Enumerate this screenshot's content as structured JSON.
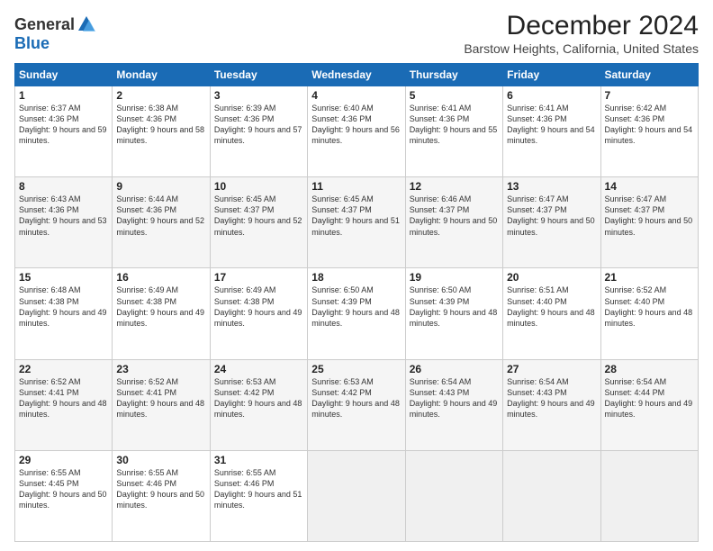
{
  "header": {
    "logo_general": "General",
    "logo_blue": "Blue",
    "title": "December 2024",
    "location": "Barstow Heights, California, United States"
  },
  "days_of_week": [
    "Sunday",
    "Monday",
    "Tuesday",
    "Wednesday",
    "Thursday",
    "Friday",
    "Saturday"
  ],
  "weeks": [
    [
      {
        "day": "1",
        "sunrise": "6:37 AM",
        "sunset": "4:36 PM",
        "daylight": "9 hours and 59 minutes."
      },
      {
        "day": "2",
        "sunrise": "6:38 AM",
        "sunset": "4:36 PM",
        "daylight": "9 hours and 58 minutes."
      },
      {
        "day": "3",
        "sunrise": "6:39 AM",
        "sunset": "4:36 PM",
        "daylight": "9 hours and 57 minutes."
      },
      {
        "day": "4",
        "sunrise": "6:40 AM",
        "sunset": "4:36 PM",
        "daylight": "9 hours and 56 minutes."
      },
      {
        "day": "5",
        "sunrise": "6:41 AM",
        "sunset": "4:36 PM",
        "daylight": "9 hours and 55 minutes."
      },
      {
        "day": "6",
        "sunrise": "6:41 AM",
        "sunset": "4:36 PM",
        "daylight": "9 hours and 54 minutes."
      },
      {
        "day": "7",
        "sunrise": "6:42 AM",
        "sunset": "4:36 PM",
        "daylight": "9 hours and 54 minutes."
      }
    ],
    [
      {
        "day": "8",
        "sunrise": "6:43 AM",
        "sunset": "4:36 PM",
        "daylight": "9 hours and 53 minutes."
      },
      {
        "day": "9",
        "sunrise": "6:44 AM",
        "sunset": "4:36 PM",
        "daylight": "9 hours and 52 minutes."
      },
      {
        "day": "10",
        "sunrise": "6:45 AM",
        "sunset": "4:37 PM",
        "daylight": "9 hours and 52 minutes."
      },
      {
        "day": "11",
        "sunrise": "6:45 AM",
        "sunset": "4:37 PM",
        "daylight": "9 hours and 51 minutes."
      },
      {
        "day": "12",
        "sunrise": "6:46 AM",
        "sunset": "4:37 PM",
        "daylight": "9 hours and 50 minutes."
      },
      {
        "day": "13",
        "sunrise": "6:47 AM",
        "sunset": "4:37 PM",
        "daylight": "9 hours and 50 minutes."
      },
      {
        "day": "14",
        "sunrise": "6:47 AM",
        "sunset": "4:37 PM",
        "daylight": "9 hours and 50 minutes."
      }
    ],
    [
      {
        "day": "15",
        "sunrise": "6:48 AM",
        "sunset": "4:38 PM",
        "daylight": "9 hours and 49 minutes."
      },
      {
        "day": "16",
        "sunrise": "6:49 AM",
        "sunset": "4:38 PM",
        "daylight": "9 hours and 49 minutes."
      },
      {
        "day": "17",
        "sunrise": "6:49 AM",
        "sunset": "4:38 PM",
        "daylight": "9 hours and 49 minutes."
      },
      {
        "day": "18",
        "sunrise": "6:50 AM",
        "sunset": "4:39 PM",
        "daylight": "9 hours and 48 minutes."
      },
      {
        "day": "19",
        "sunrise": "6:50 AM",
        "sunset": "4:39 PM",
        "daylight": "9 hours and 48 minutes."
      },
      {
        "day": "20",
        "sunrise": "6:51 AM",
        "sunset": "4:40 PM",
        "daylight": "9 hours and 48 minutes."
      },
      {
        "day": "21",
        "sunrise": "6:52 AM",
        "sunset": "4:40 PM",
        "daylight": "9 hours and 48 minutes."
      }
    ],
    [
      {
        "day": "22",
        "sunrise": "6:52 AM",
        "sunset": "4:41 PM",
        "daylight": "9 hours and 48 minutes."
      },
      {
        "day": "23",
        "sunrise": "6:52 AM",
        "sunset": "4:41 PM",
        "daylight": "9 hours and 48 minutes."
      },
      {
        "day": "24",
        "sunrise": "6:53 AM",
        "sunset": "4:42 PM",
        "daylight": "9 hours and 48 minutes."
      },
      {
        "day": "25",
        "sunrise": "6:53 AM",
        "sunset": "4:42 PM",
        "daylight": "9 hours and 48 minutes."
      },
      {
        "day": "26",
        "sunrise": "6:54 AM",
        "sunset": "4:43 PM",
        "daylight": "9 hours and 49 minutes."
      },
      {
        "day": "27",
        "sunrise": "6:54 AM",
        "sunset": "4:43 PM",
        "daylight": "9 hours and 49 minutes."
      },
      {
        "day": "28",
        "sunrise": "6:54 AM",
        "sunset": "4:44 PM",
        "daylight": "9 hours and 49 minutes."
      }
    ],
    [
      {
        "day": "29",
        "sunrise": "6:55 AM",
        "sunset": "4:45 PM",
        "daylight": "9 hours and 50 minutes."
      },
      {
        "day": "30",
        "sunrise": "6:55 AM",
        "sunset": "4:46 PM",
        "daylight": "9 hours and 50 minutes."
      },
      {
        "day": "31",
        "sunrise": "6:55 AM",
        "sunset": "4:46 PM",
        "daylight": "9 hours and 51 minutes."
      },
      null,
      null,
      null,
      null
    ]
  ]
}
